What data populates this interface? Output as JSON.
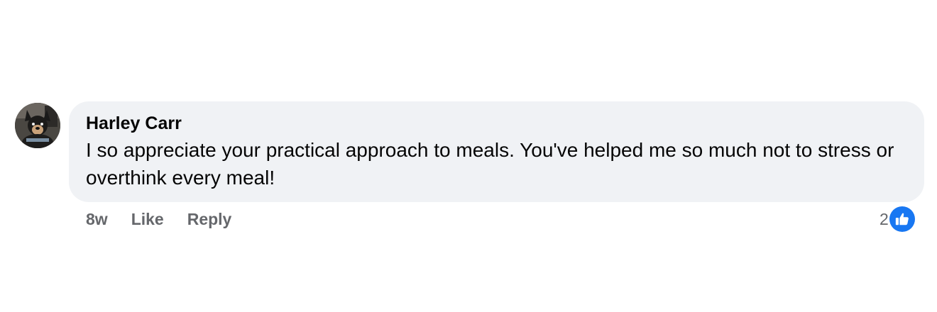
{
  "comment": {
    "author": "Harley Carr",
    "text": "I so appreciate your practical approach to meals. You've helped me so much not to stress or overthink every meal!",
    "timestamp": "8w",
    "like_label": "Like",
    "reply_label": "Reply",
    "reaction_count": "2",
    "reaction_icon": "thumbs-up-icon",
    "colors": {
      "bubble": "#f0f2f5",
      "like_badge": "#1877f2",
      "meta_text": "#65676b"
    }
  }
}
